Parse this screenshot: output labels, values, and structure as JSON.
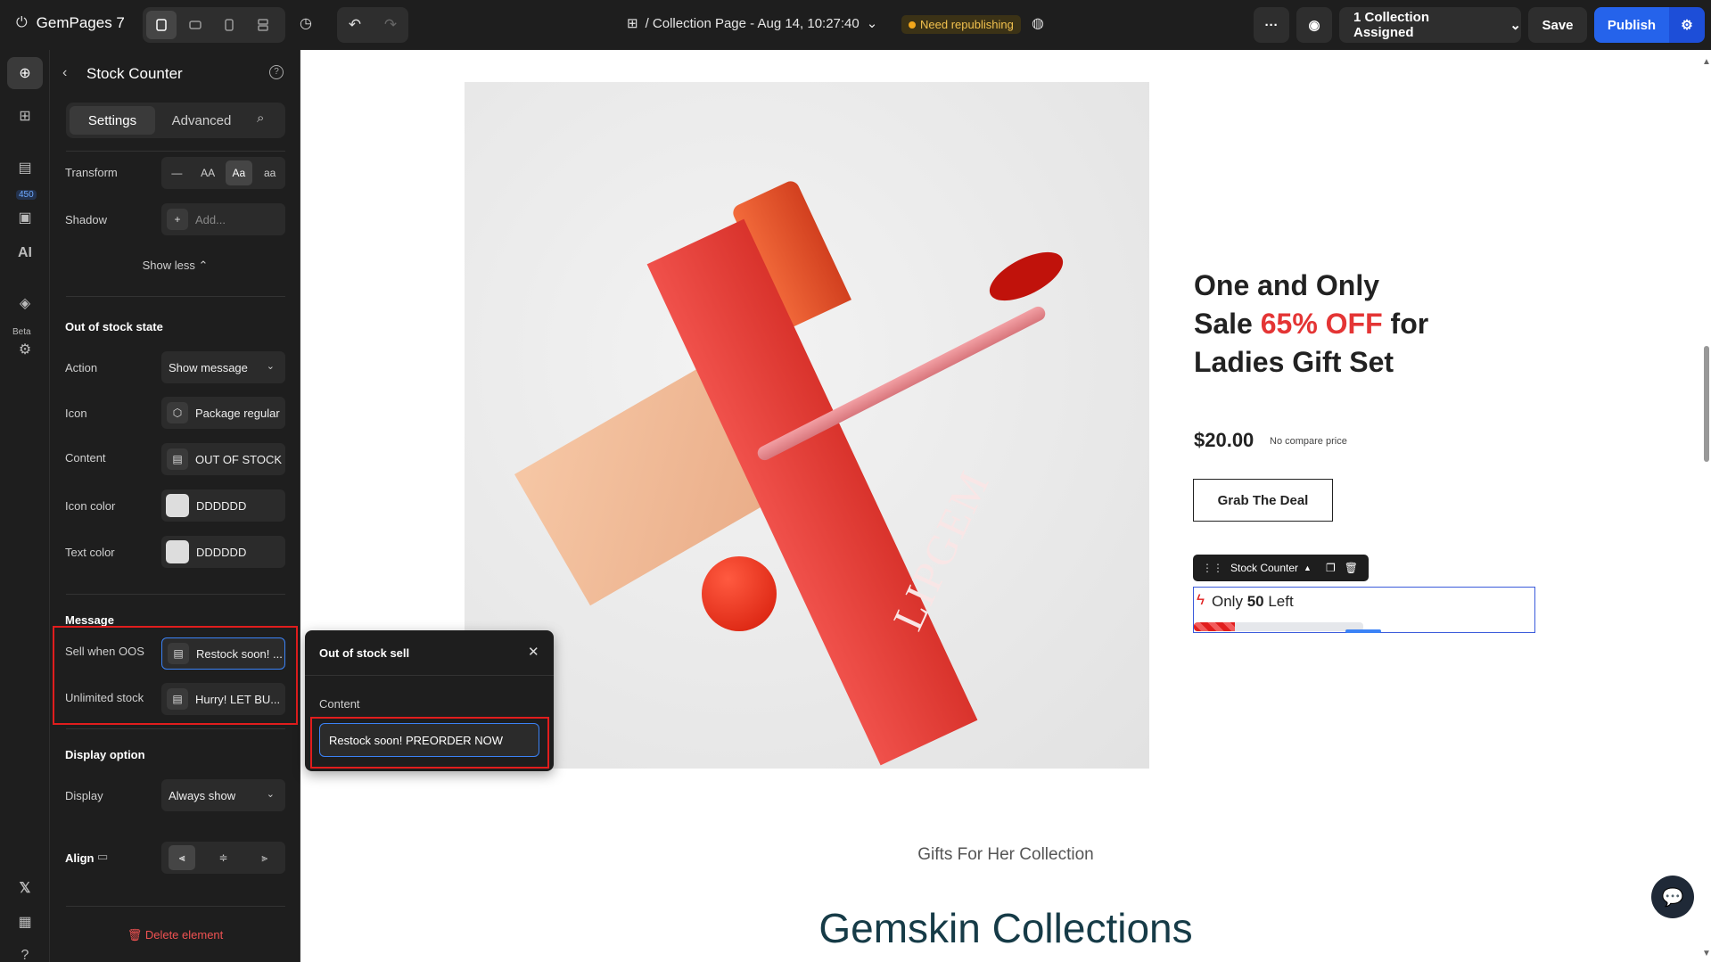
{
  "topbar": {
    "app_name": "GemPages 7",
    "page_name": "/ Collection Page - Aug 14, 10:27:40",
    "status_badge": "Need republishing",
    "collection_assigned": "1 Collection Assigned",
    "save_label": "Save",
    "publish_label": "Publish"
  },
  "rail": {
    "badge_count": "450",
    "beta_label": "Beta",
    "ai_label": "AI"
  },
  "panel": {
    "title": "Stock Counter",
    "tabs": [
      "Settings",
      "Advanced"
    ],
    "transform": {
      "label": "Transform",
      "options": [
        "—",
        "AA",
        "Aa",
        "aa"
      ],
      "selected": "Aa"
    },
    "shadow": {
      "label": "Shadow",
      "placeholder": "Add..."
    },
    "show_less": "Show less",
    "oos_section": "Out of stock state",
    "action": {
      "label": "Action",
      "value": "Show message"
    },
    "icon": {
      "label": "Icon",
      "value": "Package regular"
    },
    "content": {
      "label": "Content",
      "value": "OUT OF STOCK"
    },
    "icon_color": {
      "label": "Icon color",
      "value": "DDDDDD"
    },
    "text_color": {
      "label": "Text color",
      "value": "DDDDDD"
    },
    "message_section": "Message",
    "sell_when_oos": {
      "label": "Sell when OOS",
      "value": "Restock soon! ..."
    },
    "unlimited_stock": {
      "label": "Unlimited stock",
      "value": "Hurry! LET BU..."
    },
    "display_section": "Display option",
    "display": {
      "label": "Display",
      "value": "Always show"
    },
    "align_label": "Align",
    "delete_label": "Delete element"
  },
  "popover": {
    "title": "Out of stock sell",
    "content_label": "Content",
    "content_value": "Restock soon! PREORDER NOW"
  },
  "canvas": {
    "headline_line1": "One and Only",
    "headline_sale": "Sale ",
    "headline_discount": "65% OFF",
    "headline_for": " for",
    "headline_line3": "Ladies Gift Set",
    "price": "$20.00",
    "compare_price": "No compare price",
    "cta_label": "Grab The Deal",
    "stock_counter_label": "Stock Counter",
    "stock_only": "Only ",
    "stock_count": "50",
    "stock_left": " Left",
    "stock_fill_fraction": 0.24,
    "product_brand": "LIPGEM",
    "subheading": "Gifts For Her Collection",
    "collection_title": "Gemskin Collections"
  },
  "colors": {
    "accent_blue": "#2563eb",
    "sale_red": "#e43535",
    "highlight_red": "#e11d1d",
    "republish_amber": "#f2a71b"
  },
  "icons": [
    "exit-icon",
    "desktop-icon",
    "tablet-icon",
    "mobile-icon",
    "layout-icon",
    "history-icon",
    "undo-icon",
    "redo-icon",
    "grid-icon",
    "chevron-down-icon",
    "globe-icon",
    "more-icon",
    "eye-icon",
    "settings-icon",
    "add-icon",
    "sections-icon",
    "pages-icon",
    "layers-icon",
    "help-icon",
    "search-icon",
    "back-icon",
    "close-icon",
    "package-icon",
    "text-icon",
    "trash-icon",
    "copy-icon",
    "drag-icon",
    "bolt-icon",
    "chat-icon"
  ]
}
